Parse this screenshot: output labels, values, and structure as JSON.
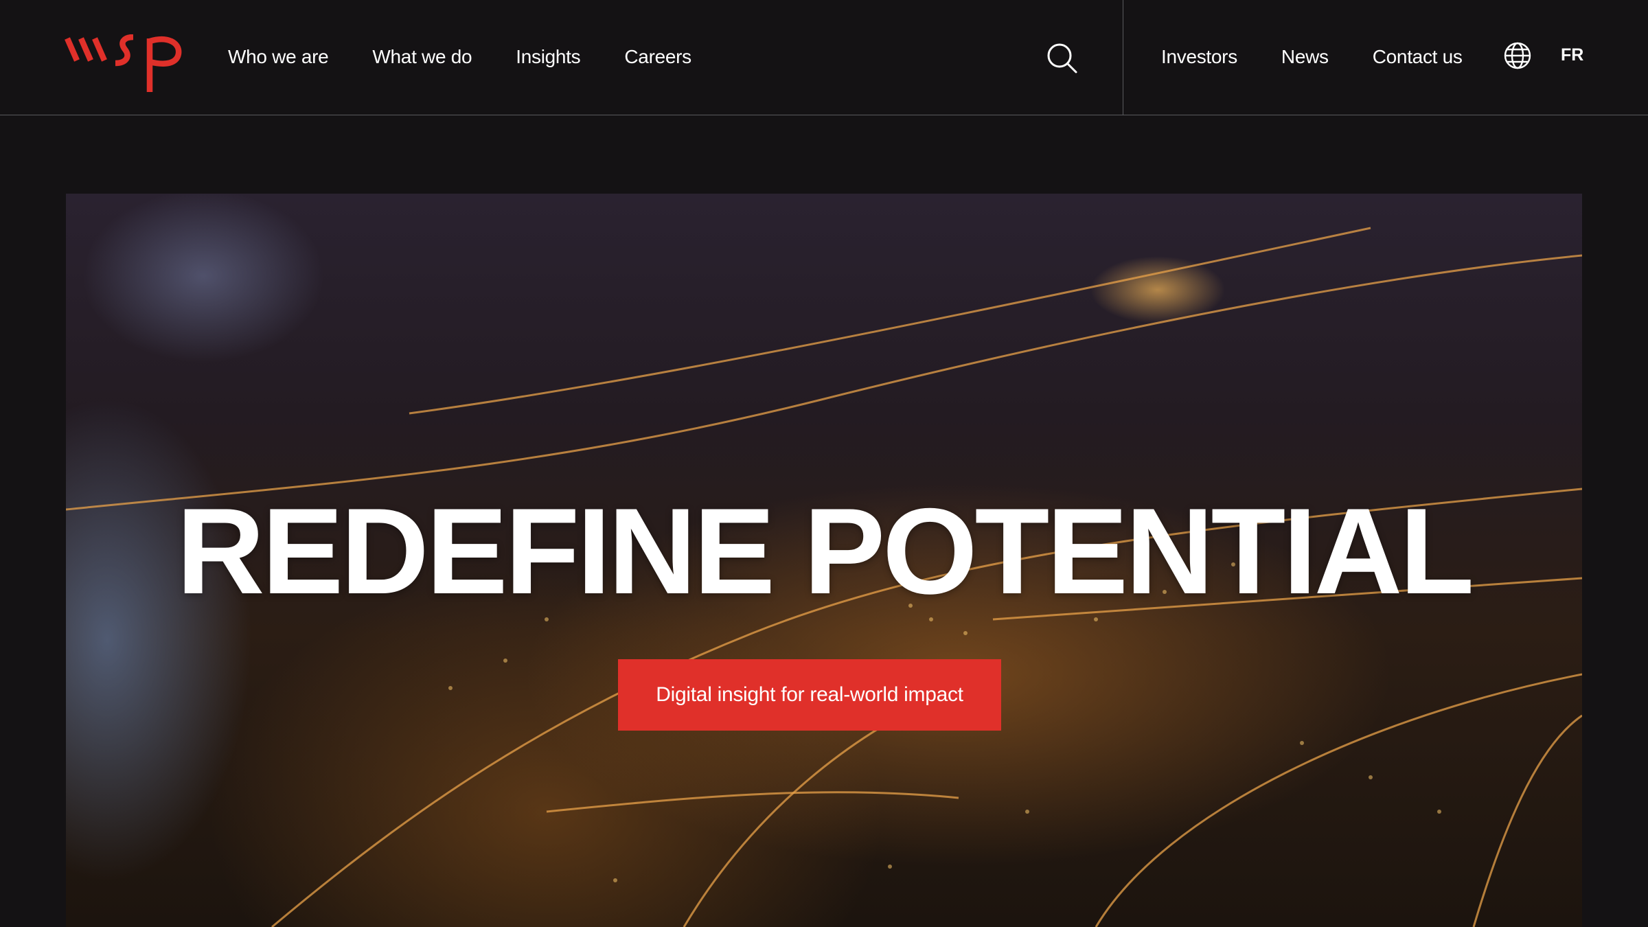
{
  "brand": {
    "name": "wsp",
    "accent_color": "#e0302a"
  },
  "nav": {
    "main": [
      {
        "label": "Who we are"
      },
      {
        "label": "What we do"
      },
      {
        "label": "Insights"
      },
      {
        "label": "Careers"
      }
    ],
    "search_icon": "search-icon",
    "utility": [
      {
        "label": "Investors"
      },
      {
        "label": "News"
      },
      {
        "label": "Contact us"
      }
    ],
    "globe_icon": "globe-icon",
    "language": "FR"
  },
  "hero": {
    "title": "REDEFINE POTENTIAL",
    "cta_label": "Digital insight for real-world impact",
    "image": "aerial-city-night"
  }
}
